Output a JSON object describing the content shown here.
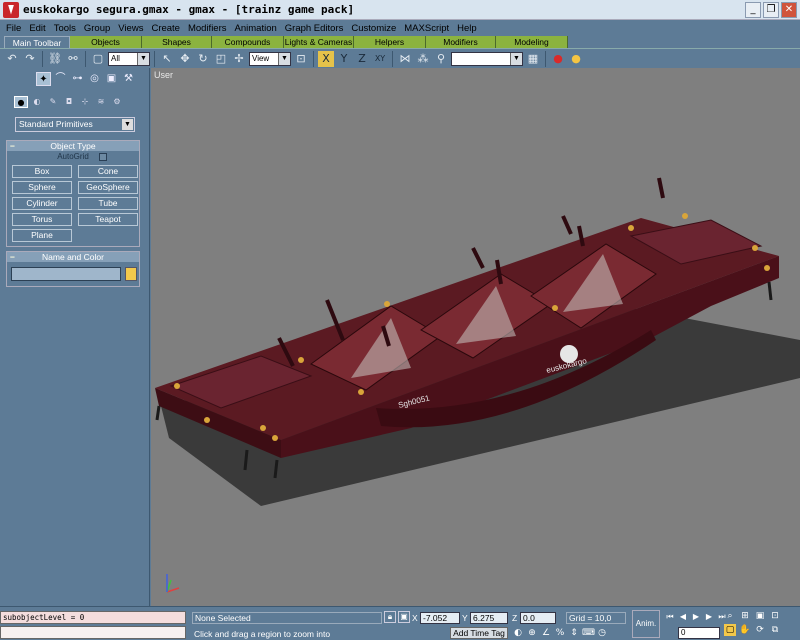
{
  "window": {
    "title": "euskokargo segura.gmax - gmax - [trainz game pack]",
    "minimize_icon": "_",
    "restore_icon": "❐",
    "close_icon": "✕"
  },
  "menu": [
    "File",
    "Edit",
    "Tools",
    "Group",
    "Views",
    "Create",
    "Modifiers",
    "Animation",
    "Graph Editors",
    "Customize",
    "MAXScript",
    "Help"
  ],
  "tabs": [
    "Main Toolbar",
    "Objects",
    "Shapes",
    "Compounds",
    "Lights & Cameras",
    "Helpers",
    "Modifiers",
    "Modeling"
  ],
  "toolbar": {
    "selection_filter": "All",
    "reference_coord": "View",
    "named_selection": "",
    "axis_x": "X",
    "axis_y": "Y",
    "axis_z": "Z",
    "axis_xy": "XY"
  },
  "command_panel": {
    "category": "Standard Primitives",
    "object_type_header": "Object Type",
    "autogrid_label": "AutoGrid",
    "buttons": [
      "Box",
      "Cone",
      "Sphere",
      "GeoSphere",
      "Cylinder",
      "Tube",
      "Torus",
      "Teapot",
      "Plane"
    ],
    "name_color_header": "Name and Color",
    "name_value": "",
    "object_color": "#f2c94c"
  },
  "viewport": {
    "label": "User",
    "model_text_1": "euskokargo",
    "model_text_2": "Sgh0051"
  },
  "status": {
    "maxscript": "subobjectLevel = 0",
    "selection": "None Selected",
    "prompt": "Click and drag a region to zoom into",
    "x_label": "X",
    "x": "-7.052",
    "y_label": "Y",
    "y": "6.275",
    "z_label": "Z",
    "z": "0.0",
    "grid": "Grid = 10,0",
    "add_time_tag": "Add Time Tag",
    "anim_button": "Anim.",
    "frame": "0"
  }
}
